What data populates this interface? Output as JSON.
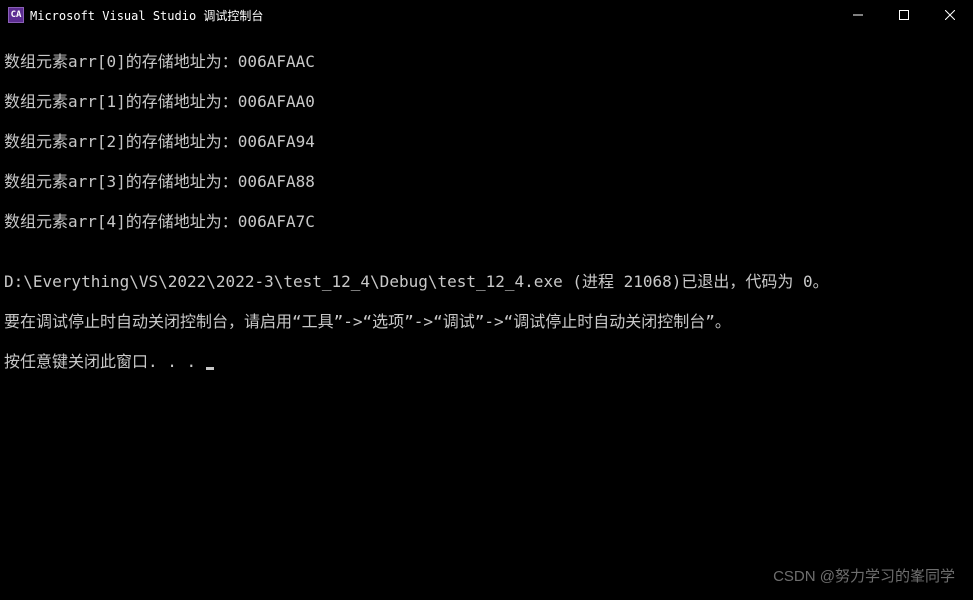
{
  "titlebar": {
    "icon_text": "CA",
    "title": "Microsoft Visual Studio 调试控制台"
  },
  "console": {
    "lines": [
      "数组元素arr[0]的存储地址为：006AFAAC",
      "数组元素arr[1]的存储地址为：006AFAA0",
      "数组元素arr[2]的存储地址为：006AFA94",
      "数组元素arr[3]的存储地址为：006AFA88",
      "数组元素arr[4]的存储地址为：006AFA7C",
      "",
      "D:\\Everything\\VS\\2022\\2022-3\\test_12_4\\Debug\\test_12_4.exe (进程 21068)已退出，代码为 0。",
      "要在调试停止时自动关闭控制台，请启用“工具”->“选项”->“调试”->“调试停止时自动关闭控制台”。"
    ],
    "prompt_line": "按任意键关闭此窗口. . . "
  },
  "watermark": "CSDN @努力学习的峯同学"
}
